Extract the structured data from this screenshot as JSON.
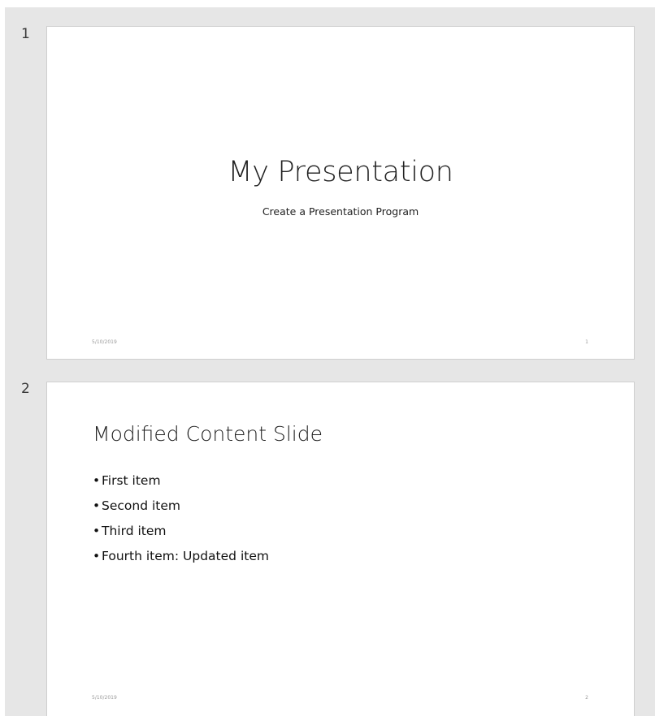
{
  "slides": [
    {
      "number": "1",
      "title": "My Presentation",
      "subtitle": "Create a Presentation Program",
      "footer_date": "5/10/2019",
      "footer_page": "1"
    },
    {
      "number": "2",
      "title": "Modified Content Slide",
      "bullets": [
        "First item",
        "Second item",
        "Third item",
        "Fourth item: Updated item"
      ],
      "footer_date": "5/10/2019",
      "footer_page": "2"
    }
  ]
}
